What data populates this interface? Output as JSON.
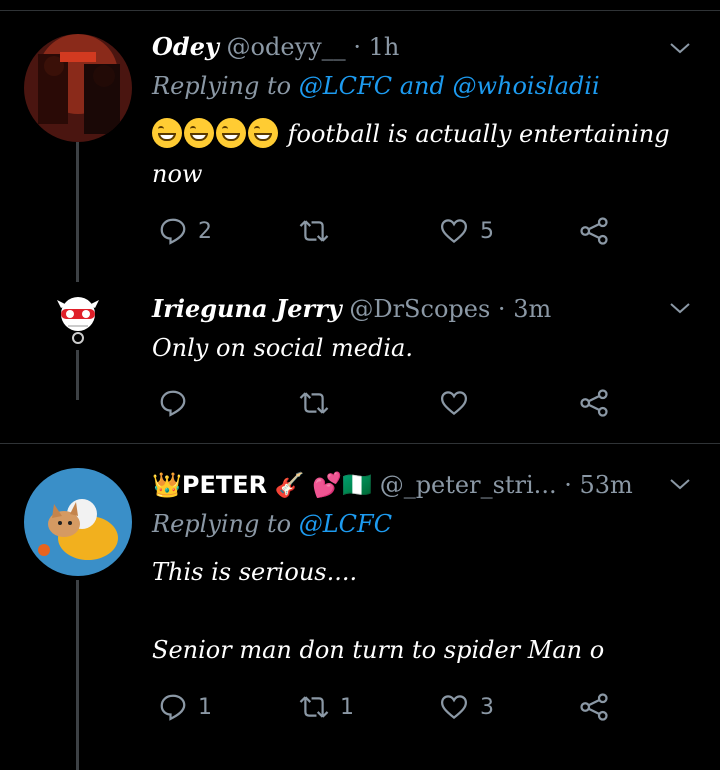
{
  "tweets": [
    {
      "name": "Odey",
      "handle": "@odeyy__",
      "dot": "·",
      "time": "1h",
      "replying_prefix": "Replying to",
      "replying_mentions": [
        "@LCFC",
        "and",
        "@whoisladii"
      ],
      "emojis": "😂😂😂😂",
      "text_line1": " football is actually entertaining",
      "text_line2": "now",
      "reply_count": "2",
      "retweet_count": "",
      "like_count": "5"
    },
    {
      "name": "Irieguna Jerry",
      "handle": "@DrScopes",
      "dot": "·",
      "time": "3m",
      "text": "Only on social media.",
      "reply_count": "",
      "retweet_count": "",
      "like_count": ""
    },
    {
      "name": "PETER",
      "name_prefix_emoji": "👑",
      "name_suffix_emojis": "🎸 💕🇳🇬",
      "handle": "@_peter_stri...",
      "dot": "·",
      "time": "53m",
      "replying_prefix": "Replying to",
      "replying_mentions": [
        "@LCFC"
      ],
      "text_line1": "This is serious....",
      "text_line2": "Senior man don turn to spider Man o",
      "reply_count": "1",
      "retweet_count": "1",
      "like_count": "3"
    }
  ],
  "icons": {
    "reply": "reply-icon",
    "retweet": "retweet-icon",
    "like": "heart-icon",
    "share": "share-icon",
    "more": "chevron-down-icon"
  },
  "colors": {
    "background": "#000000",
    "secondary_text": "#8b98a5",
    "mention": "#1d9bf0",
    "divider": "#2f3336"
  }
}
